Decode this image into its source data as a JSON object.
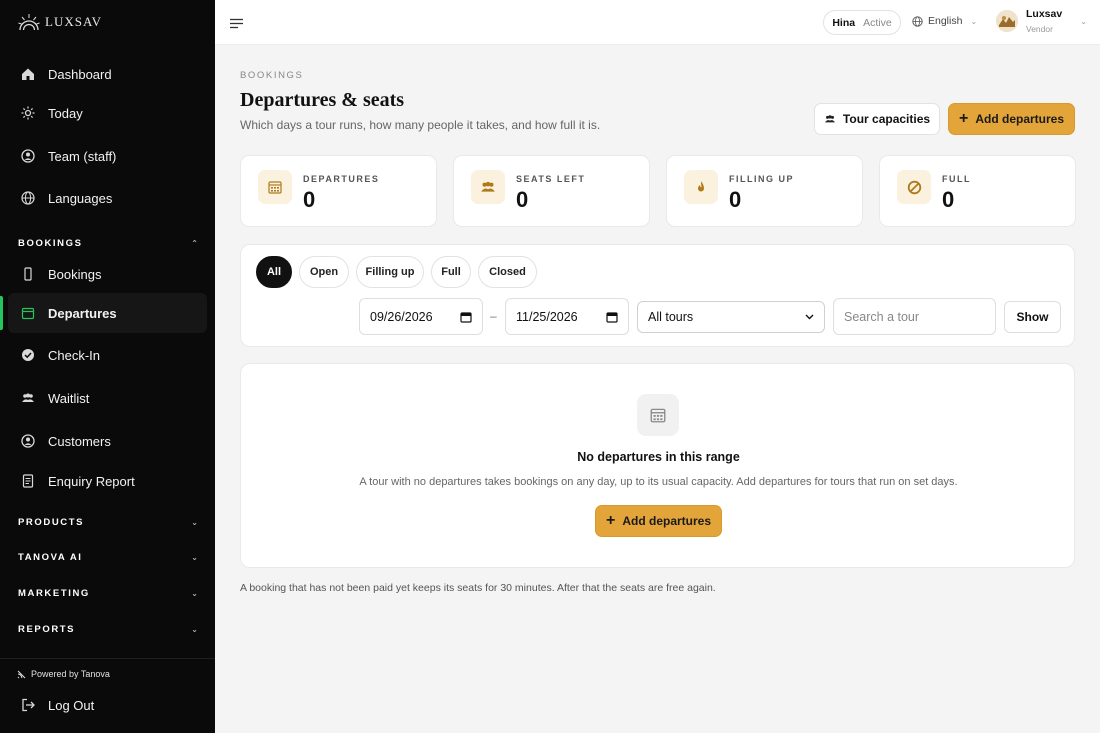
{
  "brand": {
    "name": "LUXSAV"
  },
  "sidebar": {
    "items": [
      {
        "label": "Dashboard",
        "icon": "home-icon"
      },
      {
        "label": "Today",
        "icon": "sun-icon"
      },
      {
        "label": "Team (staff)",
        "icon": "team-icon"
      },
      {
        "label": "Languages",
        "icon": "globe-icon"
      }
    ],
    "sections": {
      "bookings": "BOOKINGS",
      "products": "PRODUCTS",
      "tanova_ai": "TANOVA AI",
      "marketing": "MARKETING",
      "reports": "REPORTS"
    },
    "booking_items": [
      {
        "label": "Bookings",
        "icon": "phone-icon"
      },
      {
        "label": "Departures",
        "icon": "calendar-icon",
        "active": true
      },
      {
        "label": "Check-In",
        "icon": "check-circle-icon"
      },
      {
        "label": "Waitlist",
        "icon": "users-icon"
      },
      {
        "label": "Customers",
        "icon": "user-circle-icon"
      },
      {
        "label": "Enquiry Report",
        "icon": "report-icon"
      }
    ],
    "powered_by": "Powered by Tanova",
    "logout": "Log Out",
    "active_color": "#22c55e"
  },
  "topbar": {
    "status_name": "Hina",
    "status_state": "Active",
    "language": "English",
    "user_name": "Luxsav",
    "user_role": "Vendor"
  },
  "page": {
    "eyebrow": "BOOKINGS",
    "title": "Departures & seats",
    "subtitle": "Which days a tour runs, how many people it takes, and how full it is.",
    "tour_capacities_label": "Tour capacities",
    "add_departures_label": "Add departures",
    "accent_color": "#e3a53a"
  },
  "stats": [
    {
      "label": "DEPARTURES",
      "value": "0",
      "icon": "calendar-icon"
    },
    {
      "label": "SEATS LEFT",
      "value": "0",
      "icon": "users-icon"
    },
    {
      "label": "FILLING UP",
      "value": "0",
      "icon": "flame-icon"
    },
    {
      "label": "FULL",
      "value": "0",
      "icon": "ban-icon"
    }
  ],
  "filters": {
    "chips": [
      "All",
      "Open",
      "Filling up",
      "Full",
      "Closed"
    ],
    "active_chip": "All",
    "date_from": "09/26/2026",
    "date_to": "11/25/2026",
    "date_separator": "–",
    "tour_select": "All tours",
    "search_placeholder": "Search a tour",
    "show_label": "Show"
  },
  "empty_state": {
    "title": "No departures in this range",
    "text": "A tour with no departures takes bookings on any day, up to its usual capacity. Add departures for tours that run on set days.",
    "button_label": "Add departures"
  },
  "footnote": "A booking that has not been paid yet keeps its seats for 30 minutes. After that the seats are free again."
}
